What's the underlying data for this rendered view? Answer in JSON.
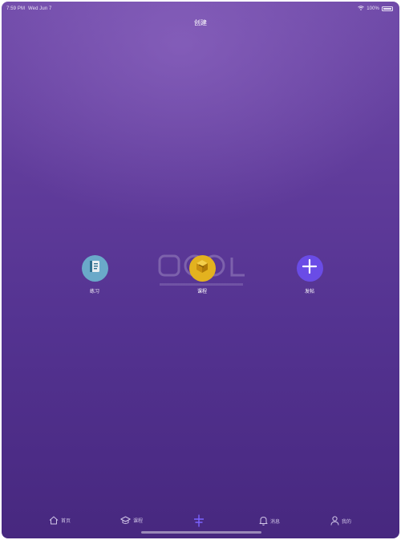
{
  "status_bar": {
    "time": "7:59 PM",
    "date": "Wed Jun 7",
    "battery": "100%"
  },
  "nav": {
    "title": "创建"
  },
  "actions": [
    {
      "label": "练习",
      "icon": "notebook-icon",
      "color": "#6aa9c9"
    },
    {
      "label": "课程",
      "icon": "box-icon",
      "color": "#e3b21f"
    },
    {
      "label": "发帖",
      "icon": "plus-icon",
      "color": "#6a4ce6"
    }
  ],
  "tab_bar": {
    "items": [
      {
        "label": "首页",
        "icon": "home-icon"
      },
      {
        "label": "课程",
        "icon": "graduation-cap-icon"
      },
      {
        "label": "",
        "icon": "create-icon",
        "active": true
      },
      {
        "label": "消息",
        "icon": "bell-icon"
      },
      {
        "label": "我的",
        "icon": "person-icon"
      }
    ]
  },
  "colors": {
    "background_top": "#6f4aa8",
    "background_bottom": "#47287f",
    "active_tab": "#7b62ff"
  }
}
